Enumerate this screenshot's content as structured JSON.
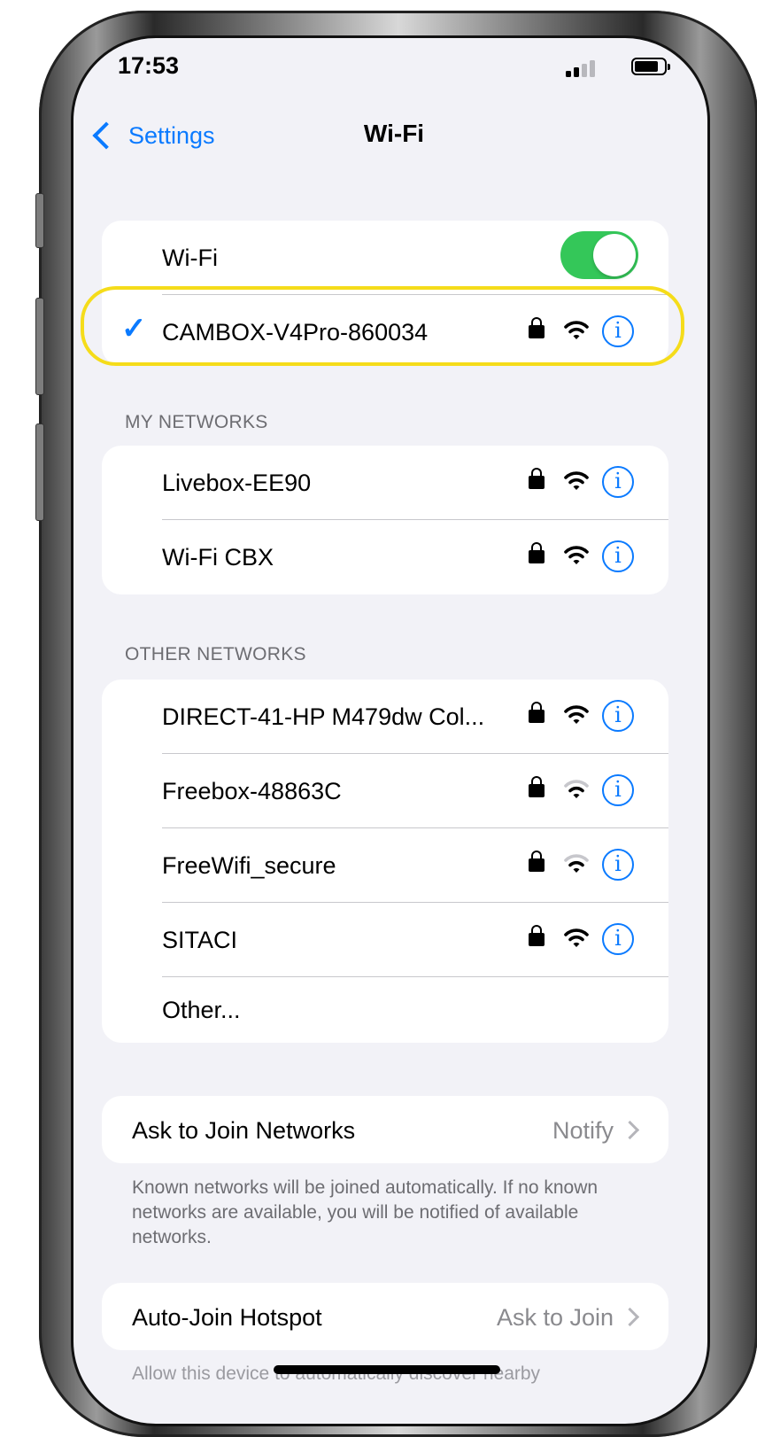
{
  "status_bar": {
    "time": "17:53"
  },
  "nav": {
    "back_label": "Settings",
    "title": "Wi-Fi"
  },
  "wifi": {
    "label": "Wi-Fi",
    "enabled": true
  },
  "connected": {
    "name": "CAMBOX-V4Pro-860034",
    "secured": true,
    "signal": "full"
  },
  "my_networks": {
    "title": "MY NETWORKS",
    "items": [
      {
        "name": "Livebox-EE90",
        "secured": true,
        "signal": "full"
      },
      {
        "name": "Wi-Fi CBX",
        "secured": true,
        "signal": "full"
      }
    ]
  },
  "other_networks": {
    "title": "OTHER NETWORKS",
    "items": [
      {
        "name": "DIRECT-41-HP M479dw Col...",
        "secured": true,
        "signal": "full"
      },
      {
        "name": "Freebox-48863C",
        "secured": true,
        "signal": "weak"
      },
      {
        "name": "FreeWifi_secure",
        "secured": true,
        "signal": "weak"
      },
      {
        "name": "SITACI",
        "secured": true,
        "signal": "full"
      }
    ],
    "other_label": "Other..."
  },
  "ask_to_join": {
    "label": "Ask to Join Networks",
    "value": "Notify",
    "footnote": "Known networks will be joined automatically. If no known networks are available, you will be notified of available networks."
  },
  "auto_join": {
    "label": "Auto-Join Hotspot",
    "value": "Ask to Join",
    "footnote": "Allow this device to automatically discover nearby"
  },
  "colors": {
    "accent": "#0a7aff",
    "toggle_on": "#34c759",
    "highlight": "#f5dc1a",
    "background": "#f2f2f7"
  },
  "icons": [
    "chevron-left-icon",
    "checkmark-icon",
    "lock-icon",
    "wifi-icon",
    "info-icon",
    "chevron-right-icon",
    "battery-icon",
    "cellular-signal-icon"
  ]
}
